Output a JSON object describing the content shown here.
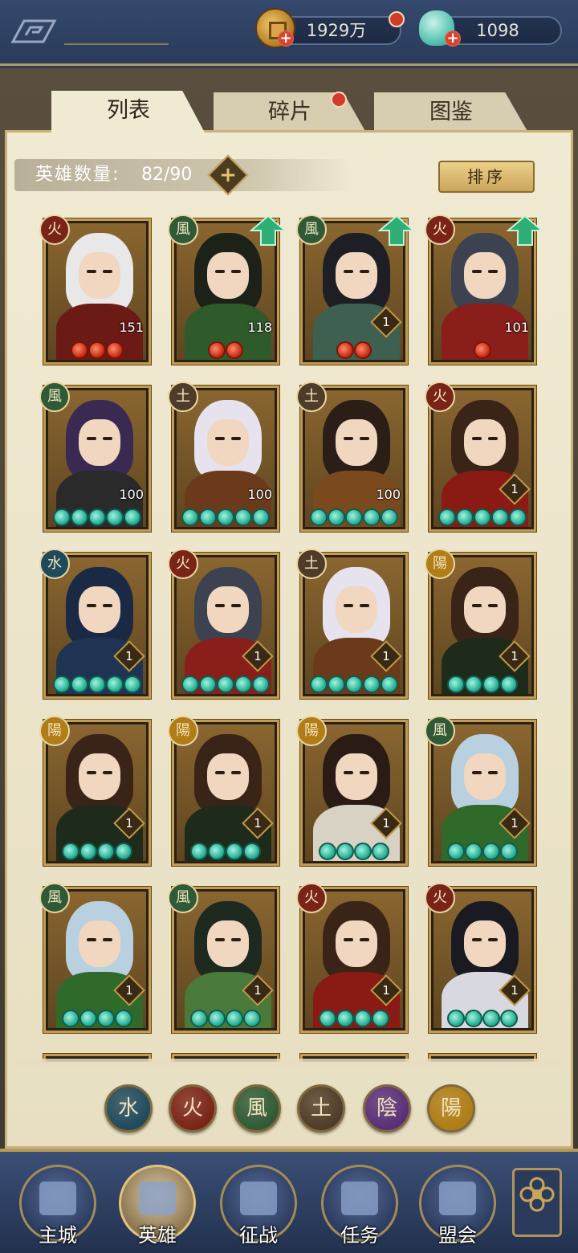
{
  "currency": {
    "gold": "1929万",
    "jade": "1098"
  },
  "tabs": [
    {
      "label": "列表",
      "active": true
    },
    {
      "label": "碎片",
      "active": false,
      "badge": true
    },
    {
      "label": "图鉴",
      "active": false
    }
  ],
  "hero_count": {
    "label": "英雄数量:",
    "value": "82/90"
  },
  "sort_label": "排序",
  "heroes": [
    {
      "element": "火",
      "level": "151",
      "stars": 3,
      "orb": "red",
      "upgrade": false,
      "hair": "#e8e8e8",
      "outfit": "#6b1a16"
    },
    {
      "element": "風",
      "level": "118",
      "stars": 2,
      "orb": "red",
      "upgrade": true,
      "hair": "#1c2218",
      "outfit": "#2f5a2a"
    },
    {
      "element": "風",
      "level": "1",
      "stars": 2,
      "orb": "red",
      "upgrade": true,
      "hair": "#1d1f24",
      "outfit": "#3e6050"
    },
    {
      "element": "火",
      "level": "101",
      "stars": 1,
      "orb": "red",
      "upgrade": true,
      "hair": "#3c4250",
      "outfit": "#8a1e1a"
    },
    {
      "element": "風",
      "level": "100",
      "stars": 5,
      "orb": "jade",
      "upgrade": false,
      "hair": "#3a2a52",
      "outfit": "#2a2a2a"
    },
    {
      "element": "土",
      "level": "100",
      "stars": 5,
      "orb": "jade",
      "upgrade": false,
      "hair": "#e6e2ee",
      "outfit": "#6a3a1a"
    },
    {
      "element": "土",
      "level": "100",
      "stars": 5,
      "orb": "jade",
      "upgrade": false,
      "hair": "#2a1e16",
      "outfit": "#7a4a1e"
    },
    {
      "element": "火",
      "level": "1",
      "stars": 5,
      "orb": "jade",
      "upgrade": false,
      "hair": "#3a2418",
      "outfit": "#8a1a14"
    },
    {
      "element": "水",
      "level": "1",
      "stars": 5,
      "orb": "jade",
      "upgrade": false,
      "hair": "#1a2a44",
      "outfit": "#1e3452"
    },
    {
      "element": "火",
      "level": "1",
      "stars": 5,
      "orb": "jade",
      "upgrade": false,
      "hair": "#3c4250",
      "outfit": "#8a1e1a"
    },
    {
      "element": "土",
      "level": "1",
      "stars": 5,
      "orb": "jade",
      "upgrade": false,
      "hair": "#e6e2ee",
      "outfit": "#6a3a1a"
    },
    {
      "element": "陽",
      "level": "1",
      "stars": 4,
      "orb": "jade",
      "upgrade": false,
      "hair": "#3a2418",
      "outfit": "#1e2a1a"
    },
    {
      "element": "陽",
      "level": "1",
      "stars": 4,
      "orb": "jade",
      "upgrade": false,
      "hair": "#3a2418",
      "outfit": "#1e2a1a"
    },
    {
      "element": "陽",
      "level": "1",
      "stars": 4,
      "orb": "jade",
      "upgrade": false,
      "hair": "#3a2418",
      "outfit": "#1e2a1a"
    },
    {
      "element": "陽",
      "level": "1",
      "stars": 4,
      "orb": "jade",
      "upgrade": false,
      "hair": "#2a1c14",
      "outfit": "#d8d2c4"
    },
    {
      "element": "風",
      "level": "1",
      "stars": 4,
      "orb": "jade",
      "upgrade": false,
      "hair": "#b8d0e0",
      "outfit": "#2f6a2a"
    },
    {
      "element": "風",
      "level": "1",
      "stars": 4,
      "orb": "jade",
      "upgrade": false,
      "hair": "#b8d0e0",
      "outfit": "#2f6a2a"
    },
    {
      "element": "風",
      "level": "1",
      "stars": 4,
      "orb": "jade",
      "upgrade": false,
      "hair": "#1e2a20",
      "outfit": "#4a7a3a"
    },
    {
      "element": "火",
      "level": "1",
      "stars": 4,
      "orb": "jade",
      "upgrade": false,
      "hair": "#3a2418",
      "outfit": "#8a1a14"
    },
    {
      "element": "火",
      "level": "1",
      "stars": 4,
      "orb": "jade",
      "upgrade": false,
      "hair": "#1a1a22",
      "outfit": "#d8d8e0"
    }
  ],
  "element_filters": [
    {
      "glyph": "水",
      "color": "#1f4a5c"
    },
    {
      "glyph": "火",
      "color": "#7a2418"
    },
    {
      "glyph": "風",
      "color": "#2f5a35"
    },
    {
      "glyph": "土",
      "color": "#4f3c28"
    },
    {
      "glyph": "陰",
      "color": "#5a2e78"
    },
    {
      "glyph": "陽",
      "color": "#b07d16"
    }
  ],
  "nav": [
    {
      "label": "主城",
      "icon": "castle-icon",
      "active": false
    },
    {
      "label": "英雄",
      "icon": "hero-icon",
      "active": true
    },
    {
      "label": "征战",
      "icon": "battle-icon",
      "active": false
    },
    {
      "label": "任务",
      "icon": "scroll-icon",
      "active": false
    },
    {
      "label": "盟会",
      "icon": "guild-icon",
      "active": false
    }
  ],
  "colors": {
    "accent_gold": "#c39c4d",
    "panel": "#f1ead3",
    "nav": "#2c3d5c"
  }
}
